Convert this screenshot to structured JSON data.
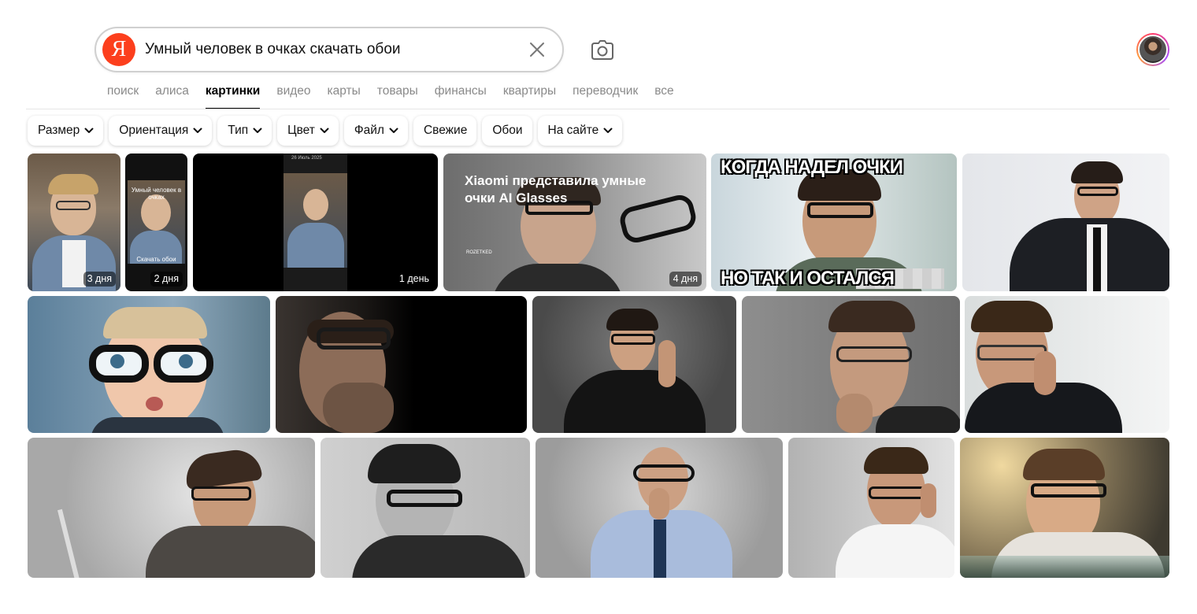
{
  "search": {
    "query": "Умный человек в очках скачать обои",
    "logo_letter": "Я"
  },
  "icons": {
    "clear": "close-icon",
    "camera": "camera-icon",
    "chevron": "chevron-down-icon"
  },
  "colors": {
    "brand": "#fc3f1d",
    "active_tab": "#000000",
    "inactive_tab": "#8a8a8a"
  },
  "tabs": [
    {
      "label": "поиск",
      "active": false
    },
    {
      "label": "алиса",
      "active": false
    },
    {
      "label": "картинки",
      "active": true
    },
    {
      "label": "видео",
      "active": false
    },
    {
      "label": "карты",
      "active": false
    },
    {
      "label": "товары",
      "active": false
    },
    {
      "label": "финансы",
      "active": false
    },
    {
      "label": "квартиры",
      "active": false
    },
    {
      "label": "переводчик",
      "active": false
    },
    {
      "label": "все",
      "active": false
    }
  ],
  "filters": [
    {
      "label": "Размер",
      "dropdown": true
    },
    {
      "label": "Ориентация",
      "dropdown": true
    },
    {
      "label": "Тип",
      "dropdown": true
    },
    {
      "label": "Цвет",
      "dropdown": true
    },
    {
      "label": "Файл",
      "dropdown": true
    },
    {
      "label": "Свежие",
      "dropdown": false
    },
    {
      "label": "Обои",
      "dropdown": false
    },
    {
      "label": "На сайте",
      "dropdown": true
    }
  ],
  "results": [
    {
      "badge": "3 дня"
    },
    {
      "badge": "2 дня",
      "overlay_top": "Умный человек в очках",
      "overlay_bottom": "Скачать обои"
    },
    {
      "badge": "1 день",
      "phone_date": "26 Июль 2025"
    },
    {
      "badge": "4 дня",
      "headline": "Xiaomi представила умные очки AI Glasses",
      "watermark": "ROZETKED"
    },
    {
      "meme_top": "КОГДА НАДЕЛ ОЧКИ",
      "meme_bottom": "НО ТАК И ОСТАЛСЯ"
    },
    {},
    {},
    {},
    {},
    {},
    {},
    {},
    {},
    {},
    {},
    {}
  ]
}
